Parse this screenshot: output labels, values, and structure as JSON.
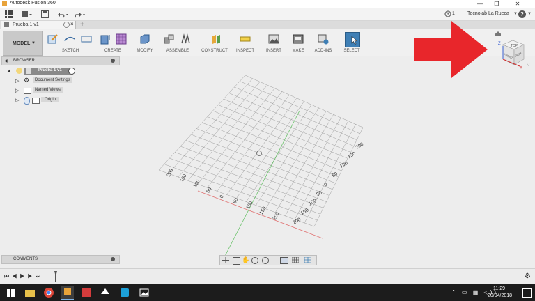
{
  "window": {
    "title": "Autodesk Fusion 360"
  },
  "qat": {
    "user_name": "Tecnolab La Rueca",
    "job_status_count": "1",
    "help_label": "?"
  },
  "document": {
    "tab_title": "Prueba 1 v1",
    "new_tab_symbol": "+"
  },
  "toolbar": {
    "workspace_label": "MODEL",
    "groups": [
      {
        "label": "SKETCH"
      },
      {
        "label": "CREATE"
      },
      {
        "label": "MODIFY"
      },
      {
        "label": "ASSEMBLE"
      },
      {
        "label": "CONSTRUCT"
      },
      {
        "label": "INSPECT"
      },
      {
        "label": "INSERT"
      },
      {
        "label": "MAKE"
      },
      {
        "label": "ADD-INS"
      },
      {
        "label": "SELECT"
      }
    ]
  },
  "browser": {
    "title": "BROWSER",
    "root": "Prueba 1 v1",
    "items": [
      {
        "label": "Document Settings"
      },
      {
        "label": "Named Views"
      },
      {
        "label": "Origin"
      }
    ]
  },
  "comments": {
    "title": "COMMENTS"
  },
  "grid": {
    "right_ticks": [
      "200",
      "150",
      "100",
      "50",
      "0",
      "50",
      "100",
      "150",
      "200"
    ],
    "bottom_ticks": [
      "200",
      "150",
      "100",
      "50",
      "0",
      "50",
      "100",
      "150",
      "200"
    ]
  },
  "viewcube": {
    "top_label": "TOP",
    "front_label": "FRONT",
    "right_label": "RIGHT",
    "z_axis": "Z",
    "x_axis": "X"
  },
  "taskbar": {
    "time": "11:29",
    "date": "20/04/2018"
  },
  "colors": {
    "arrow": "#e8262b",
    "grid_x_axis": "#e07070",
    "grid_y_axis": "#6bc26b",
    "select_icon": "#3f7fb5"
  }
}
